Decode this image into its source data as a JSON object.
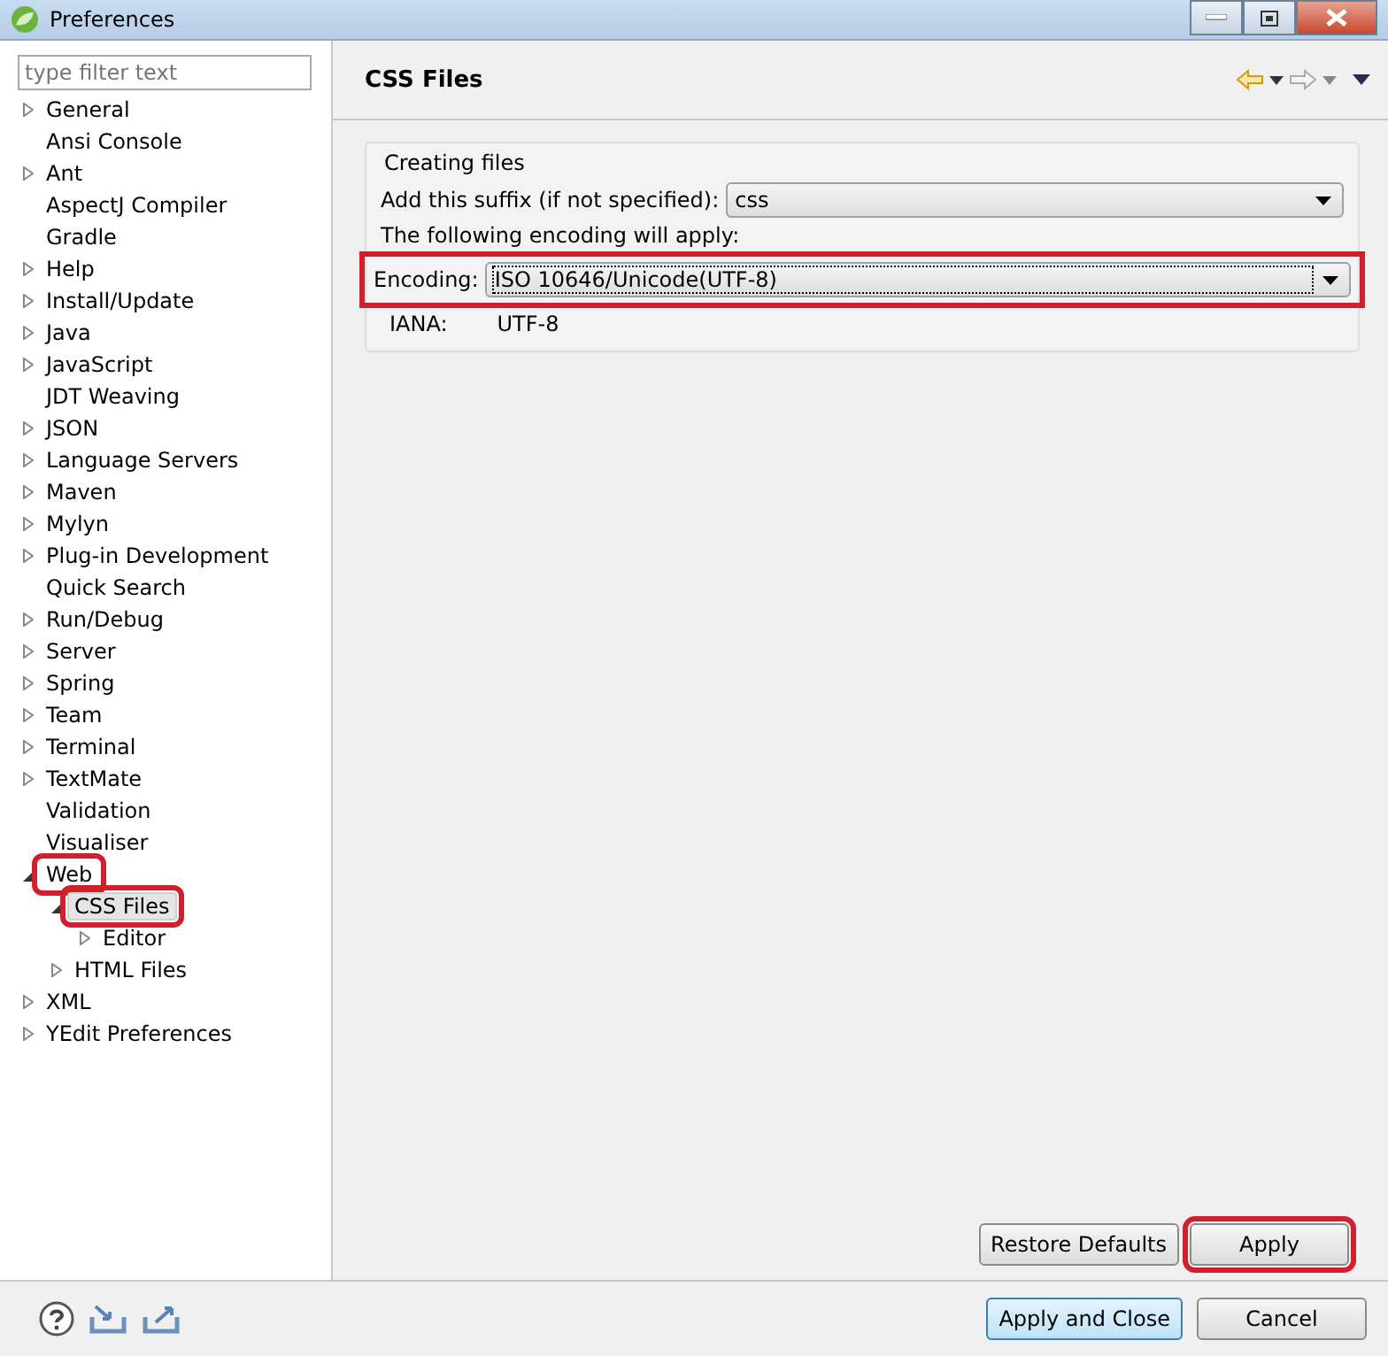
{
  "window": {
    "title": "Preferences"
  },
  "filter": {
    "placeholder": "type filter text"
  },
  "tree": [
    {
      "label": "General",
      "kind": "folder",
      "expanded": false,
      "selected": false,
      "highlight": false
    },
    {
      "label": "Ansi Console",
      "kind": "leaf",
      "selected": false,
      "highlight": false
    },
    {
      "label": "Ant",
      "kind": "folder",
      "expanded": false,
      "selected": false,
      "highlight": false
    },
    {
      "label": "AspectJ Compiler",
      "kind": "leaf",
      "selected": false,
      "highlight": false
    },
    {
      "label": "Gradle",
      "kind": "leaf",
      "selected": false,
      "highlight": false
    },
    {
      "label": "Help",
      "kind": "folder",
      "expanded": false,
      "selected": false,
      "highlight": false
    },
    {
      "label": "Install/Update",
      "kind": "folder",
      "expanded": false,
      "selected": false,
      "highlight": false
    },
    {
      "label": "Java",
      "kind": "folder",
      "expanded": false,
      "selected": false,
      "highlight": false
    },
    {
      "label": "JavaScript",
      "kind": "folder",
      "expanded": false,
      "selected": false,
      "highlight": false
    },
    {
      "label": "JDT Weaving",
      "kind": "leaf",
      "selected": false,
      "highlight": false
    },
    {
      "label": "JSON",
      "kind": "folder",
      "expanded": false,
      "selected": false,
      "highlight": false
    },
    {
      "label": "Language Servers",
      "kind": "folder",
      "expanded": false,
      "selected": false,
      "highlight": false
    },
    {
      "label": "Maven",
      "kind": "folder",
      "expanded": false,
      "selected": false,
      "highlight": false
    },
    {
      "label": "Mylyn",
      "kind": "folder",
      "expanded": false,
      "selected": false,
      "highlight": false
    },
    {
      "label": "Plug-in Development",
      "kind": "folder",
      "expanded": false,
      "selected": false,
      "highlight": false
    },
    {
      "label": "Quick Search",
      "kind": "leaf",
      "selected": false,
      "highlight": false
    },
    {
      "label": "Run/Debug",
      "kind": "folder",
      "expanded": false,
      "selected": false,
      "highlight": false
    },
    {
      "label": "Server",
      "kind": "folder",
      "expanded": false,
      "selected": false,
      "highlight": false
    },
    {
      "label": "Spring",
      "kind": "folder",
      "expanded": false,
      "selected": false,
      "highlight": false
    },
    {
      "label": "Team",
      "kind": "folder",
      "expanded": false,
      "selected": false,
      "highlight": false
    },
    {
      "label": "Terminal",
      "kind": "folder",
      "expanded": false,
      "selected": false,
      "highlight": false
    },
    {
      "label": "TextMate",
      "kind": "folder",
      "expanded": false,
      "selected": false,
      "highlight": false
    },
    {
      "label": "Validation",
      "kind": "leaf",
      "selected": false,
      "highlight": false
    },
    {
      "label": "Visualiser",
      "kind": "leaf",
      "selected": false,
      "highlight": false
    },
    {
      "label": "Web",
      "kind": "folder",
      "expanded": true,
      "selected": false,
      "highlight": true,
      "children": [
        {
          "label": "CSS Files",
          "kind": "folder",
          "expanded": true,
          "selected": true,
          "highlight": true,
          "children": [
            {
              "label": "Editor",
              "kind": "folder",
              "expanded": false,
              "selected": false,
              "highlight": false
            }
          ]
        },
        {
          "label": "HTML Files",
          "kind": "folder",
          "expanded": false,
          "selected": false,
          "highlight": false
        }
      ]
    },
    {
      "label": "XML",
      "kind": "folder",
      "expanded": false,
      "selected": false,
      "highlight": false
    },
    {
      "label": "YEdit Preferences",
      "kind": "folder",
      "expanded": false,
      "selected": false,
      "highlight": false
    }
  ],
  "page": {
    "title": "CSS Files",
    "group": {
      "title": "Creating files",
      "suffix": {
        "label": "Add this suffix (if not specified):",
        "value": "css"
      },
      "note": "The following encoding will apply:",
      "encoding": {
        "label": "Encoding:",
        "value": "ISO 10646/Unicode(UTF-8)",
        "highlight": true
      },
      "iana": {
        "label": "IANA:",
        "value": "UTF-8"
      }
    }
  },
  "page_buttons": [
    {
      "label": "Restore Defaults",
      "highlight": false
    },
    {
      "label": "Apply",
      "highlight": true
    }
  ],
  "dialog_buttons": [
    {
      "label": "Apply and Close",
      "default": true
    },
    {
      "label": "Cancel",
      "default": false
    }
  ]
}
